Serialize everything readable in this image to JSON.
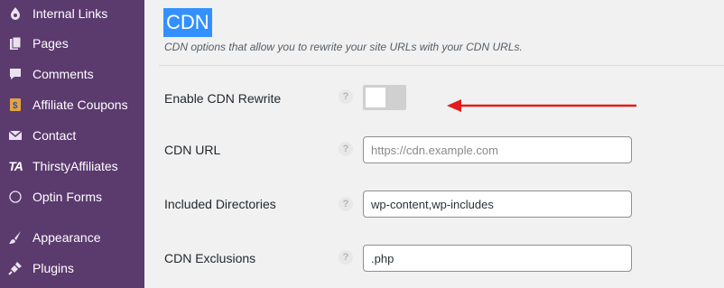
{
  "sidebar": {
    "items": [
      {
        "label": "Internal Links",
        "icon": "internal-links-icon"
      },
      {
        "label": "Pages",
        "icon": "pages-icon"
      },
      {
        "label": "Comments",
        "icon": "comments-icon"
      },
      {
        "label": "Affiliate Coupons",
        "icon": "coupon-icon"
      },
      {
        "label": "Contact",
        "icon": "envelope-icon"
      },
      {
        "label": "ThirstyAffiliates",
        "icon": "ta-logo-icon",
        "logo_text": "TA"
      },
      {
        "label": "Optin Forms",
        "icon": "circle-icon"
      },
      {
        "label": "Appearance",
        "icon": "paintbrush-icon"
      },
      {
        "label": "Plugins",
        "icon": "plug-icon"
      }
    ]
  },
  "main": {
    "title": "CDN",
    "subtitle": "CDN options that allow you to rewrite your site URLs with your CDN URLs.",
    "help_glyph": "?",
    "rows": {
      "enable": {
        "label": "Enable CDN Rewrite",
        "toggle_on": false
      },
      "cdn_url": {
        "label": "CDN URL",
        "value": "",
        "placeholder": "https://cdn.example.com"
      },
      "included": {
        "label": "Included Directories",
        "value": "wp-content,wp-includes"
      },
      "exclusions": {
        "label": "CDN Exclusions",
        "value": ".php"
      }
    }
  },
  "colors": {
    "sidebar_bg": "#5b3a6e",
    "title_highlight": "#3390ff",
    "arrow": "#e31b1b",
    "toggle_off": "#d0d0d0"
  }
}
